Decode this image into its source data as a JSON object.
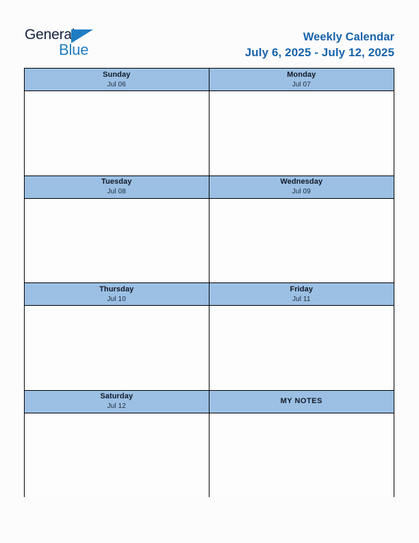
{
  "page": {
    "background_color": "#fcfcfc",
    "header_fill_color": "#9bc0e4",
    "border_color": "#000000",
    "accent_color": "#1763ab",
    "logo_blue_color": "#1f7cc2"
  },
  "logo": {
    "word_one": "General",
    "word_two": "Blue",
    "mark": "triangle-right-icon"
  },
  "header": {
    "title": "Weekly Calendar",
    "date_range": "July 6, 2025 - July 12, 2025"
  },
  "calendar": {
    "bands": [
      {
        "cells": [
          {
            "kind": "day",
            "day_name": "Sunday",
            "date_label": "Jul 06",
            "note_text": ""
          },
          {
            "kind": "day",
            "day_name": "Monday",
            "date_label": "Jul 07",
            "note_text": ""
          }
        ]
      },
      {
        "cells": [
          {
            "kind": "day",
            "day_name": "Tuesday",
            "date_label": "Jul 08",
            "note_text": ""
          },
          {
            "kind": "day",
            "day_name": "Wednesday",
            "date_label": "Jul 09",
            "note_text": ""
          }
        ]
      },
      {
        "cells": [
          {
            "kind": "day",
            "day_name": "Thursday",
            "date_label": "Jul 10",
            "note_text": ""
          },
          {
            "kind": "day",
            "day_name": "Friday",
            "date_label": "Jul 11",
            "note_text": ""
          }
        ]
      },
      {
        "cells": [
          {
            "kind": "day",
            "day_name": "Saturday",
            "date_label": "Jul 12",
            "note_text": ""
          },
          {
            "kind": "notes",
            "day_name": "MY NOTES",
            "date_label": "",
            "note_text": ""
          }
        ]
      }
    ]
  }
}
